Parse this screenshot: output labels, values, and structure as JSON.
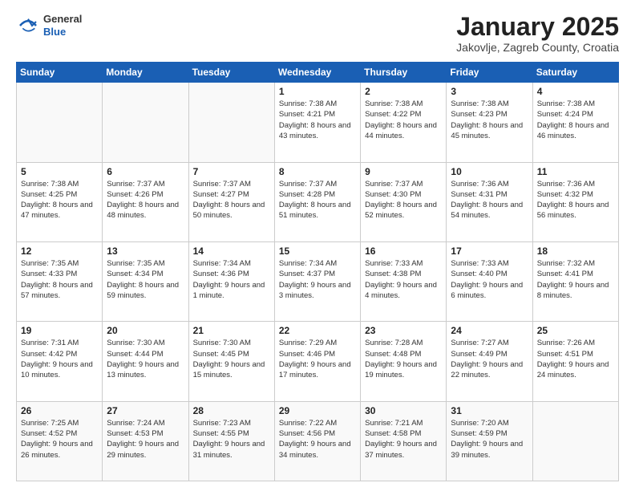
{
  "logo": {
    "general": "General",
    "blue": "Blue"
  },
  "header": {
    "month": "January 2025",
    "location": "Jakovlje, Zagreb County, Croatia"
  },
  "weekdays": [
    "Sunday",
    "Monday",
    "Tuesday",
    "Wednesday",
    "Thursday",
    "Friday",
    "Saturday"
  ],
  "weeks": [
    [
      {
        "day": "",
        "sunrise": "",
        "sunset": "",
        "daylight": ""
      },
      {
        "day": "",
        "sunrise": "",
        "sunset": "",
        "daylight": ""
      },
      {
        "day": "",
        "sunrise": "",
        "sunset": "",
        "daylight": ""
      },
      {
        "day": "1",
        "sunrise": "Sunrise: 7:38 AM",
        "sunset": "Sunset: 4:21 PM",
        "daylight": "Daylight: 8 hours and 43 minutes."
      },
      {
        "day": "2",
        "sunrise": "Sunrise: 7:38 AM",
        "sunset": "Sunset: 4:22 PM",
        "daylight": "Daylight: 8 hours and 44 minutes."
      },
      {
        "day": "3",
        "sunrise": "Sunrise: 7:38 AM",
        "sunset": "Sunset: 4:23 PM",
        "daylight": "Daylight: 8 hours and 45 minutes."
      },
      {
        "day": "4",
        "sunrise": "Sunrise: 7:38 AM",
        "sunset": "Sunset: 4:24 PM",
        "daylight": "Daylight: 8 hours and 46 minutes."
      }
    ],
    [
      {
        "day": "5",
        "sunrise": "Sunrise: 7:38 AM",
        "sunset": "Sunset: 4:25 PM",
        "daylight": "Daylight: 8 hours and 47 minutes."
      },
      {
        "day": "6",
        "sunrise": "Sunrise: 7:37 AM",
        "sunset": "Sunset: 4:26 PM",
        "daylight": "Daylight: 8 hours and 48 minutes."
      },
      {
        "day": "7",
        "sunrise": "Sunrise: 7:37 AM",
        "sunset": "Sunset: 4:27 PM",
        "daylight": "Daylight: 8 hours and 50 minutes."
      },
      {
        "day": "8",
        "sunrise": "Sunrise: 7:37 AM",
        "sunset": "Sunset: 4:28 PM",
        "daylight": "Daylight: 8 hours and 51 minutes."
      },
      {
        "day": "9",
        "sunrise": "Sunrise: 7:37 AM",
        "sunset": "Sunset: 4:30 PM",
        "daylight": "Daylight: 8 hours and 52 minutes."
      },
      {
        "day": "10",
        "sunrise": "Sunrise: 7:36 AM",
        "sunset": "Sunset: 4:31 PM",
        "daylight": "Daylight: 8 hours and 54 minutes."
      },
      {
        "day": "11",
        "sunrise": "Sunrise: 7:36 AM",
        "sunset": "Sunset: 4:32 PM",
        "daylight": "Daylight: 8 hours and 56 minutes."
      }
    ],
    [
      {
        "day": "12",
        "sunrise": "Sunrise: 7:35 AM",
        "sunset": "Sunset: 4:33 PM",
        "daylight": "Daylight: 8 hours and 57 minutes."
      },
      {
        "day": "13",
        "sunrise": "Sunrise: 7:35 AM",
        "sunset": "Sunset: 4:34 PM",
        "daylight": "Daylight: 8 hours and 59 minutes."
      },
      {
        "day": "14",
        "sunrise": "Sunrise: 7:34 AM",
        "sunset": "Sunset: 4:36 PM",
        "daylight": "Daylight: 9 hours and 1 minute."
      },
      {
        "day": "15",
        "sunrise": "Sunrise: 7:34 AM",
        "sunset": "Sunset: 4:37 PM",
        "daylight": "Daylight: 9 hours and 3 minutes."
      },
      {
        "day": "16",
        "sunrise": "Sunrise: 7:33 AM",
        "sunset": "Sunset: 4:38 PM",
        "daylight": "Daylight: 9 hours and 4 minutes."
      },
      {
        "day": "17",
        "sunrise": "Sunrise: 7:33 AM",
        "sunset": "Sunset: 4:40 PM",
        "daylight": "Daylight: 9 hours and 6 minutes."
      },
      {
        "day": "18",
        "sunrise": "Sunrise: 7:32 AM",
        "sunset": "Sunset: 4:41 PM",
        "daylight": "Daylight: 9 hours and 8 minutes."
      }
    ],
    [
      {
        "day": "19",
        "sunrise": "Sunrise: 7:31 AM",
        "sunset": "Sunset: 4:42 PM",
        "daylight": "Daylight: 9 hours and 10 minutes."
      },
      {
        "day": "20",
        "sunrise": "Sunrise: 7:30 AM",
        "sunset": "Sunset: 4:44 PM",
        "daylight": "Daylight: 9 hours and 13 minutes."
      },
      {
        "day": "21",
        "sunrise": "Sunrise: 7:30 AM",
        "sunset": "Sunset: 4:45 PM",
        "daylight": "Daylight: 9 hours and 15 minutes."
      },
      {
        "day": "22",
        "sunrise": "Sunrise: 7:29 AM",
        "sunset": "Sunset: 4:46 PM",
        "daylight": "Daylight: 9 hours and 17 minutes."
      },
      {
        "day": "23",
        "sunrise": "Sunrise: 7:28 AM",
        "sunset": "Sunset: 4:48 PM",
        "daylight": "Daylight: 9 hours and 19 minutes."
      },
      {
        "day": "24",
        "sunrise": "Sunrise: 7:27 AM",
        "sunset": "Sunset: 4:49 PM",
        "daylight": "Daylight: 9 hours and 22 minutes."
      },
      {
        "day": "25",
        "sunrise": "Sunrise: 7:26 AM",
        "sunset": "Sunset: 4:51 PM",
        "daylight": "Daylight: 9 hours and 24 minutes."
      }
    ],
    [
      {
        "day": "26",
        "sunrise": "Sunrise: 7:25 AM",
        "sunset": "Sunset: 4:52 PM",
        "daylight": "Daylight: 9 hours and 26 minutes."
      },
      {
        "day": "27",
        "sunrise": "Sunrise: 7:24 AM",
        "sunset": "Sunset: 4:53 PM",
        "daylight": "Daylight: 9 hours and 29 minutes."
      },
      {
        "day": "28",
        "sunrise": "Sunrise: 7:23 AM",
        "sunset": "Sunset: 4:55 PM",
        "daylight": "Daylight: 9 hours and 31 minutes."
      },
      {
        "day": "29",
        "sunrise": "Sunrise: 7:22 AM",
        "sunset": "Sunset: 4:56 PM",
        "daylight": "Daylight: 9 hours and 34 minutes."
      },
      {
        "day": "30",
        "sunrise": "Sunrise: 7:21 AM",
        "sunset": "Sunset: 4:58 PM",
        "daylight": "Daylight: 9 hours and 37 minutes."
      },
      {
        "day": "31",
        "sunrise": "Sunrise: 7:20 AM",
        "sunset": "Sunset: 4:59 PM",
        "daylight": "Daylight: 9 hours and 39 minutes."
      },
      {
        "day": "",
        "sunrise": "",
        "sunset": "",
        "daylight": ""
      }
    ]
  ]
}
